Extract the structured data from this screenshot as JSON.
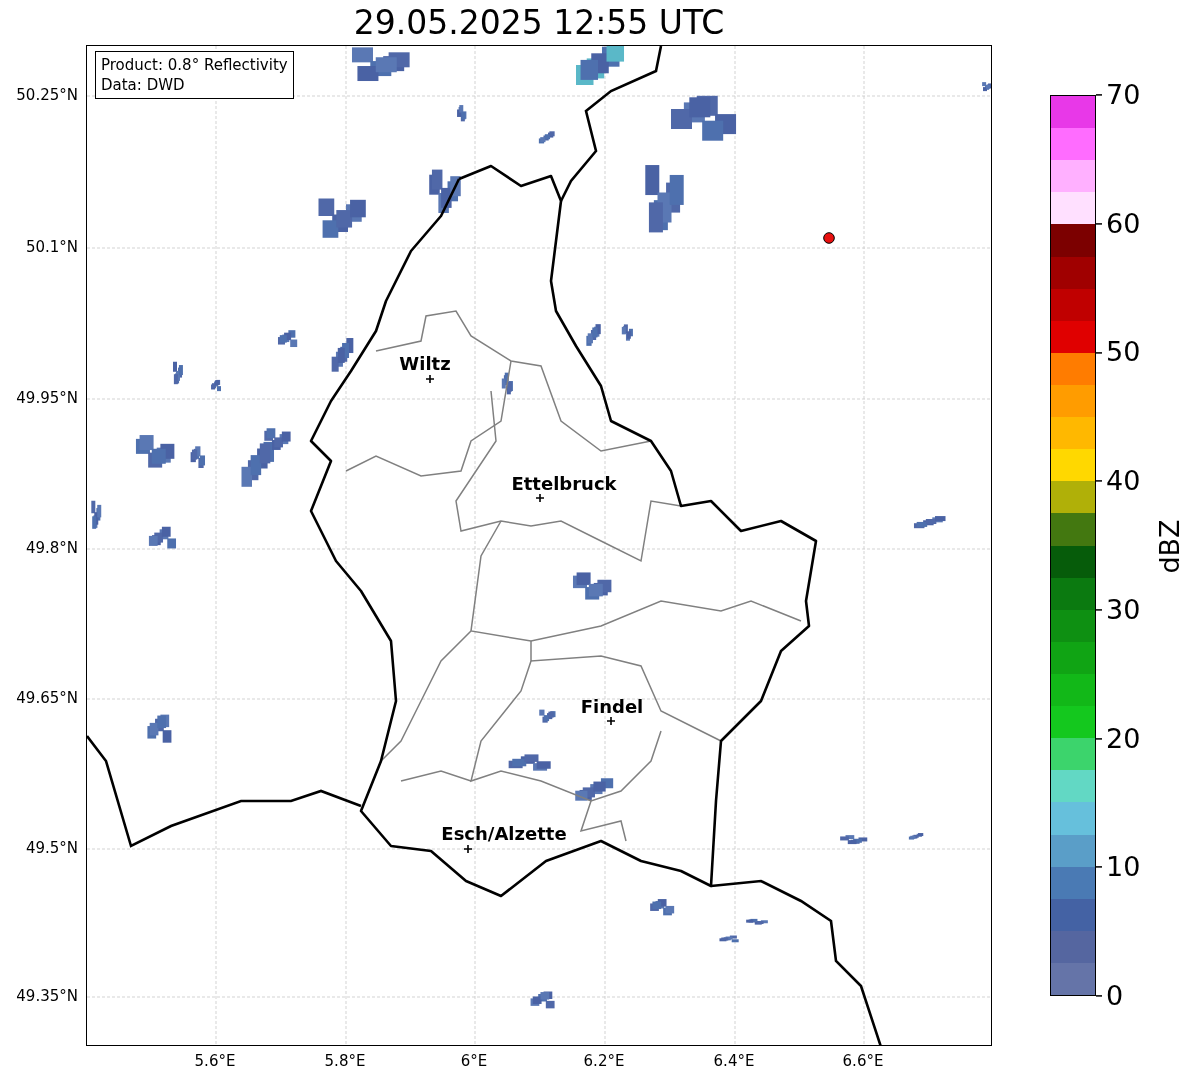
{
  "title": "29.05.2025 12:55 UTC",
  "info_box": [
    "Product: 0.8° Reflectivity",
    "Data: DWD"
  ],
  "x_ticks": [
    "5.6°E",
    "5.8°E",
    "6°E",
    "6.2°E",
    "6.4°E",
    "6.6°E"
  ],
  "y_ticks": [
    "50.25°N",
    "50.1°N",
    "49.95°N",
    "49.8°N",
    "49.65°N",
    "49.5°N",
    "49.35°N"
  ],
  "cities": [
    {
      "name": "Wiltz"
    },
    {
      "name": "Ettelbruck"
    },
    {
      "name": "Findel"
    },
    {
      "name": "Esch/Alzette"
    }
  ],
  "colorbar": {
    "label": "dBZ",
    "ticks": [
      "70",
      "60",
      "50",
      "40",
      "30",
      "20",
      "10",
      "0"
    ],
    "segments": [
      {
        "color": "#e838e8"
      },
      {
        "color": "#ff6cff"
      },
      {
        "color": "#ffb0ff"
      },
      {
        "color": "#ffe0ff"
      },
      {
        "color": "#7c0000"
      },
      {
        "color": "#a00000"
      },
      {
        "color": "#c00000"
      },
      {
        "color": "#e00000"
      },
      {
        "color": "#ff7c00"
      },
      {
        "color": "#ff9c00"
      },
      {
        "color": "#ffb800"
      },
      {
        "color": "#ffd800"
      },
      {
        "color": "#b0b008"
      },
      {
        "color": "#437810"
      },
      {
        "color": "#065c0a"
      },
      {
        "color": "#0b7a10"
      },
      {
        "color": "#0e9012"
      },
      {
        "color": "#10a414"
      },
      {
        "color": "#12b818"
      },
      {
        "color": "#14c81e"
      },
      {
        "color": "#3cd46c"
      },
      {
        "color": "#62d8c4"
      },
      {
        "color": "#66c0dc"
      },
      {
        "color": "#5a9ec8"
      },
      {
        "color": "#4a7ab4"
      },
      {
        "color": "#4462a4"
      },
      {
        "color": "#5566a0"
      },
      {
        "color": "#6574a8"
      }
    ]
  }
}
